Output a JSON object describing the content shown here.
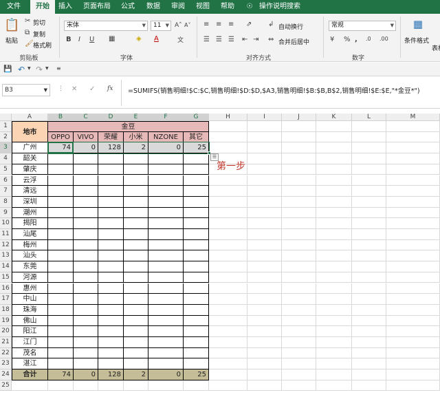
{
  "tabs": [
    "文件",
    "开始",
    "插入",
    "页面布局",
    "公式",
    "数据",
    "审阅",
    "视图",
    "帮助",
    "操作说明搜索"
  ],
  "ribbon": {
    "paste": "粘贴",
    "cut": "剪切",
    "copy": "复制",
    "format_painter": "格式刷",
    "clipboard_group": "剪贴板",
    "font_name": "宋体",
    "font_size": "11",
    "font_group": "字体",
    "wrap_text": "自动换行",
    "merge_center": "合并后居中",
    "align_group": "对齐方式",
    "number_format": "常规",
    "number_group": "数字",
    "cond_format": "条件格式",
    "table_label": "表格"
  },
  "namebox": "B3",
  "formula": "=SUMIFS(销售明细!$C:$C,销售明细!$D:$D,$A3,销售明细!$B:$B,B$2,销售明细!$E:$E,\"*金豆*\")",
  "columns": [
    "A",
    "B",
    "C",
    "D",
    "E",
    "F",
    "G",
    "H",
    "I",
    "J",
    "K",
    "L",
    "M"
  ],
  "rows": [
    "1",
    "2",
    "3",
    "4",
    "5",
    "6",
    "7",
    "8",
    "9",
    "10",
    "11",
    "12",
    "13",
    "14",
    "15",
    "16",
    "17",
    "18",
    "19",
    "20",
    "21",
    "22",
    "23",
    "24",
    "25"
  ],
  "table": {
    "header_city": "地市",
    "header_group": "金豆",
    "brands": [
      "OPPO",
      "VIVO",
      "荣耀",
      "小米",
      "NZONE",
      "其它"
    ],
    "cities": [
      "广州",
      "韶关",
      "肇庆",
      "云浮",
      "清远",
      "深圳",
      "潮州",
      "揭阳",
      "汕尾",
      "梅州",
      "汕头",
      "东莞",
      "河源",
      "惠州",
      "中山",
      "珠海",
      "佛山",
      "阳江",
      "江门",
      "茂名",
      "湛江"
    ],
    "row3_values": [
      "74",
      "0",
      "128",
      "2",
      "0",
      "25"
    ],
    "total_label": "合计",
    "total_values": [
      "74",
      "0",
      "128",
      "2",
      "0",
      "25"
    ]
  },
  "annotation": "第一步",
  "colors": {
    "excel_green": "#217346",
    "header_pink": "#e6b8b7",
    "city_peach": "#fbd4b4",
    "total_tan": "#c4bd97",
    "selected_gray": "#d9d9d9",
    "annotation_red": "#c0392b"
  }
}
